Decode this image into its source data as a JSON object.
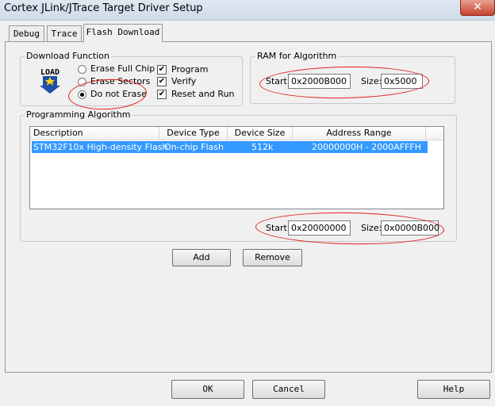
{
  "window": {
    "title": "Cortex JLink/JTrace Target Driver Setup",
    "close_glyph": "✕"
  },
  "tabs": [
    {
      "label": "Debug"
    },
    {
      "label": "Trace"
    },
    {
      "label": "Flash Download",
      "active": true
    }
  ],
  "download_function": {
    "group_label": "Download Function",
    "icon_text": "LOAD",
    "radios": [
      {
        "label": "Erase Full Chip",
        "checked": false
      },
      {
        "label": "Erase Sectors",
        "checked": false
      },
      {
        "label": "Do not Erase",
        "checked": true
      }
    ],
    "checkboxes": [
      {
        "label": "Program",
        "checked": true
      },
      {
        "label": "Verify",
        "checked": true
      },
      {
        "label": "Reset and Run",
        "checked": true
      }
    ]
  },
  "ram_for_algorithm": {
    "group_label": "RAM for Algorithm",
    "start_label": "Start:",
    "start_value": "0x2000B000",
    "size_label": "Size:",
    "size_value": "0x5000"
  },
  "programming_algorithm": {
    "group_label": "Programming Algorithm",
    "columns": [
      "Description",
      "Device Type",
      "Device Size",
      "Address Range"
    ],
    "rows": [
      {
        "description": "STM32F10x High-density Flash",
        "device_type": "On-chip Flash",
        "device_size": "512k",
        "address_range": "20000000H - 2000AFFFH",
        "selected": true
      }
    ],
    "start_label": "Start:",
    "start_value": "0x20000000",
    "size_label": "Size:",
    "size_value": "0x0000B000",
    "add_label": "Add",
    "remove_label": "Remove"
  },
  "footer": {
    "ok_label": "OK",
    "cancel_label": "Cancel",
    "help_label": "Help"
  },
  "colors": {
    "selection": "#3399ff",
    "annotation": "#e0201c"
  },
  "icons": {
    "load": "load-icon",
    "close": "close-icon",
    "check": "checkmark-icon"
  }
}
